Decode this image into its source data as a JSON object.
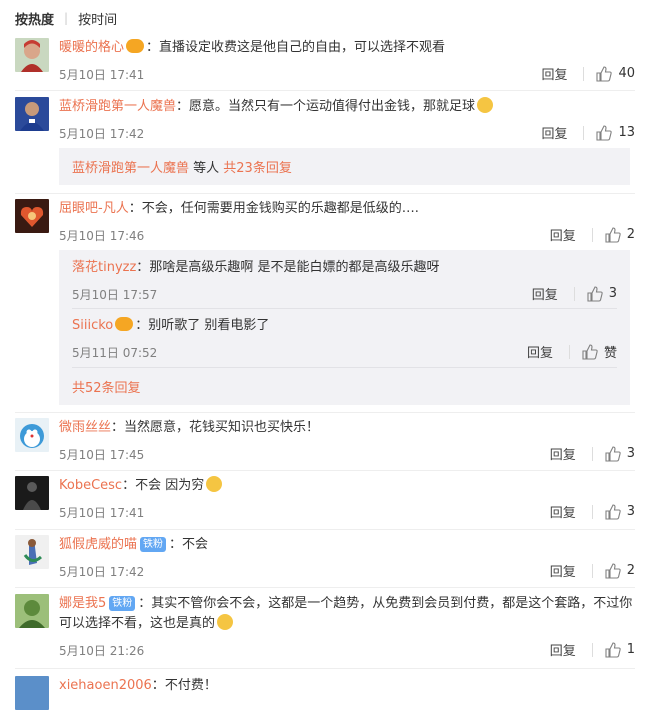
{
  "sort": {
    "hot": "按热度",
    "time": "按时间"
  },
  "comments": [
    {
      "name": "暖暖的格心",
      "sep": "：",
      "text": "直播设定收费这是他自己的自由，可以选择不观看",
      "time": "5月10日 17:41",
      "reply": "回复",
      "likes": "40"
    },
    {
      "name": "蓝桥滑跑第一人魔兽",
      "sep": "：",
      "text": "愿意。当然只有一个运动值得付出金钱，那就足球",
      "time": "5月10日 17:42",
      "reply": "回复",
      "likes": "13",
      "summary": {
        "name": "蓝桥滑跑第一人魔兽",
        "mid": " 等人 ",
        "link": "共23条回复"
      }
    },
    {
      "name": "屈眼吧-凡人",
      "sep": "：",
      "text": "不会，任何需要用金钱购买的乐趣都是低级的….",
      "time": "5月10日 17:46",
      "reply": "回复",
      "likes": "2",
      "replies": [
        {
          "name": "落花tinyzz",
          "sep": "：",
          "text": "那啥是高级乐趣啊 是不是能白嫖的都是高级乐趣呀",
          "time": "5月10日 17:57",
          "reply": "回复",
          "likes": "3"
        },
        {
          "name": "Siiicko",
          "sep": "：",
          "text": "别听歌了 别看电影了",
          "time": "5月11日 07:52",
          "reply": "回复",
          "likes": "赞"
        }
      ],
      "more": "共52条回复"
    },
    {
      "name": "微雨丝丝",
      "sep": "：",
      "text": "当然愿意，花钱买知识也买快乐！",
      "time": "5月10日 17:45",
      "reply": "回复",
      "likes": "3"
    },
    {
      "name": "KobeCesc",
      "sep": "：",
      "text": "不会 因为穷",
      "time": "5月10日 17:41",
      "reply": "回复",
      "likes": "3"
    },
    {
      "name": "狐假虎威的喵",
      "badge": "铁粉",
      "sep": "：",
      "text": "不会",
      "time": "5月10日 17:42",
      "reply": "回复",
      "likes": "2"
    },
    {
      "name": "娜是我5",
      "badge": "铁粉",
      "sep": "：",
      "text": "其实不管你会不会，这都是一个趋势，从免费到会员到付费，都是这个套路，不过你可以选择不看，这也是真的",
      "time": "5月10日 21:26",
      "reply": "回复",
      "likes": "1"
    },
    {
      "name": "xiehaoen2006",
      "sep": "：",
      "text": "不付费！"
    }
  ],
  "colors": {
    "name": "#eb7350",
    "bg_sub": "#f2f2f5",
    "meta": "#808080"
  }
}
